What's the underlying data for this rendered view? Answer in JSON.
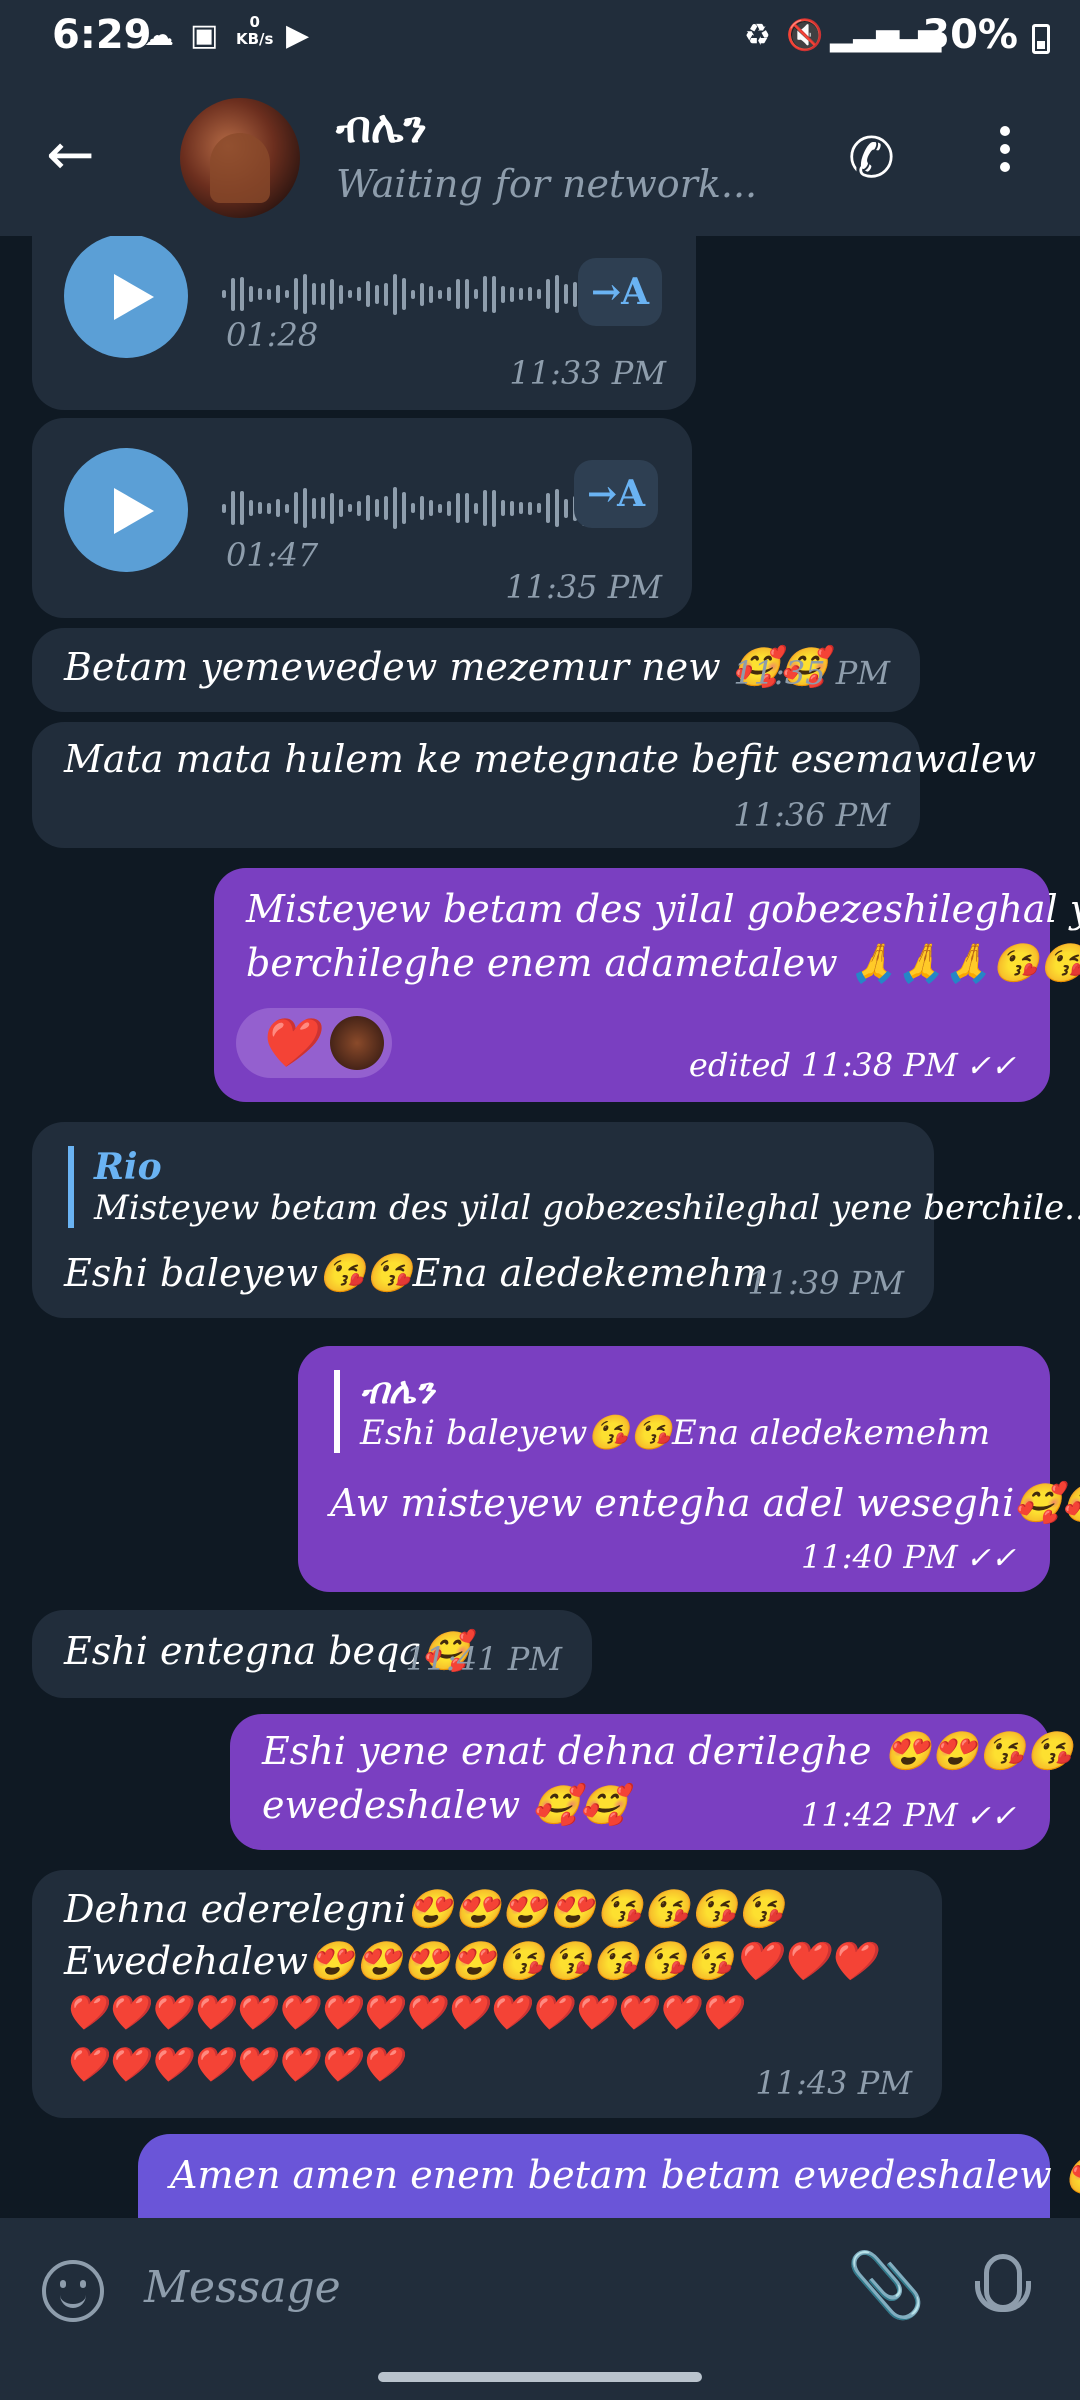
{
  "status_bar": {
    "time": "6:29",
    "kb_value": "0",
    "kb_unit": "KB/s",
    "battery": "30%"
  },
  "header": {
    "title": "ብሌን",
    "status": "Waiting for network...",
    "back_icon": "arrow-left-icon",
    "call_icon": "phone-icon",
    "menu_icon": "more-vertical-icon"
  },
  "messages": [
    {
      "type": "voice",
      "duration": "01:28",
      "time": "11:33 PM",
      "transcribe": "→A"
    },
    {
      "type": "voice",
      "duration": "01:47",
      "time": "11:35 PM",
      "transcribe": "→A"
    },
    {
      "type": "text",
      "text": "Betam yemewedew mezemur new 🥰🥰",
      "time": "11:35 PM"
    },
    {
      "type": "text",
      "text": "Mata mata hulem ke metegnate befit esemawalew",
      "time": "11:36 PM"
    },
    {
      "type": "outgoing",
      "text_line1": "Misteyew betam des yilal gobezeshileghal yene",
      "text_line2": "berchileghe enem adametalew 🙏🙏🙏😘😘",
      "time": "edited 11:38 PM",
      "reaction": "❤️"
    },
    {
      "type": "reply",
      "reply_name": "Rio",
      "reply_text": "Misteyew betam des yilal gobezeshileghal yene berchile...",
      "text": "Eshi baleyew😘😘Ena aledekemehm",
      "time": "11:39 PM"
    },
    {
      "type": "outgoing_reply",
      "reply_name": "ብሌን",
      "reply_text": "Eshi baleyew😘😘Ena aledekemehm",
      "text": "Aw misteyew entegha adel weseghi🥰🥰",
      "time": "11:40 PM"
    },
    {
      "type": "text",
      "text": "Eshi entegna beqa🥰",
      "time": "11:41 PM"
    },
    {
      "type": "outgoing",
      "text_line1": "Eshi yene enat dehna derileghe 😍😍😘😘",
      "text_line2": "ewedeshalew 🥰🥰",
      "time": "11:42 PM"
    },
    {
      "type": "text_multi",
      "line1": "Dehna ederelegni😍😍😍😍😘😘😘😘",
      "line2": "Ewedehalew😍😍😍😍😘😘😘😘😘❤️❤️❤️",
      "line3": "❤️❤️❤️❤️❤️❤️❤️❤️❤️❤️❤️❤️❤️❤️❤️❤️",
      "line4": "❤️❤️❤️❤️❤️❤️❤️❤️",
      "time": "11:43 PM"
    },
    {
      "type": "outgoing_partial",
      "text_line1": "Amen amen enem betam betam ewedeshalew 😍"
    }
  ],
  "composer": {
    "placeholder": "Message",
    "emoji_icon": "emoji-icon",
    "attach_icon": "paperclip-icon",
    "mic_icon": "microphone-icon"
  },
  "colors": {
    "header": "#212d3b",
    "background": "#0f1923",
    "incoming": "#212d3b",
    "outgoing": "#7a3fc1",
    "accent": "#6ab3f3"
  }
}
